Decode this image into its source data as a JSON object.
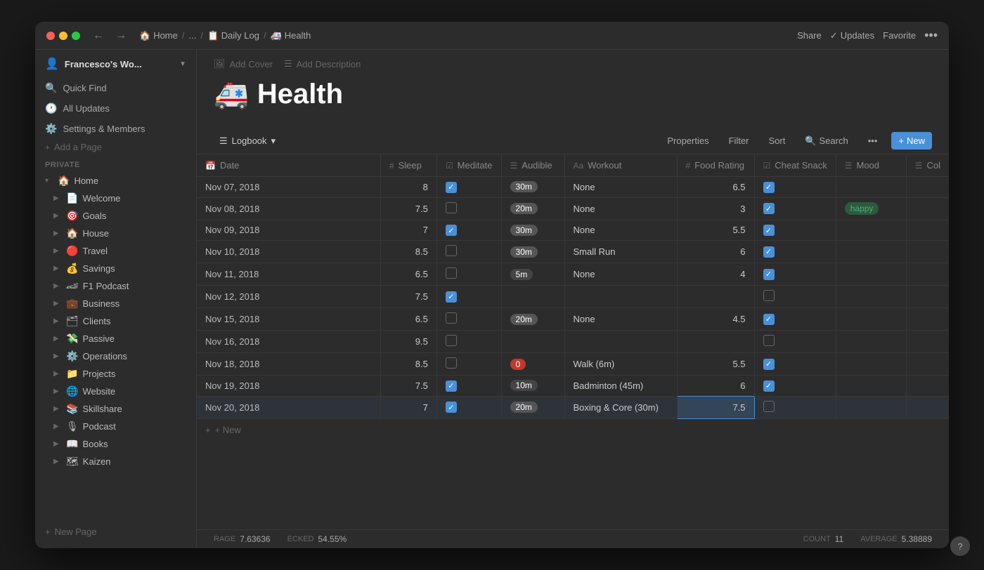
{
  "window": {
    "title": "Francesco's Wo..."
  },
  "titlebar": {
    "back_label": "←",
    "forward_label": "→",
    "breadcrumb": [
      {
        "icon": "🏠",
        "label": "Home"
      },
      {
        "sep": "/"
      },
      {
        "label": "..."
      },
      {
        "sep": "/"
      },
      {
        "icon": "📋",
        "label": "Daily Log"
      },
      {
        "sep": "/"
      },
      {
        "icon": "🚑",
        "label": "Health"
      }
    ],
    "share_label": "Share",
    "updates_label": "Updates",
    "favorite_label": "Favorite",
    "more_label": "•••"
  },
  "sidebar": {
    "workspace_name": "Francesco's Wo...",
    "search_label": "Quick Find",
    "updates_label": "All Updates",
    "settings_label": "Settings & Members",
    "add_page_label": "Add a Page",
    "section_label": "PRIVATE",
    "items": [
      {
        "icon": "🏠",
        "label": "Home",
        "expanded": true,
        "indent": 0
      },
      {
        "icon": "📄",
        "label": "Welcome",
        "indent": 1
      },
      {
        "icon": "🎯",
        "label": "Goals",
        "indent": 1
      },
      {
        "icon": "🏠",
        "label": "House",
        "indent": 1
      },
      {
        "icon": "🔴",
        "label": "Travel",
        "indent": 1
      },
      {
        "icon": "💰",
        "label": "Savings",
        "indent": 1
      },
      {
        "icon": "🏎",
        "label": "F1 Podcast",
        "indent": 1
      },
      {
        "icon": "💼",
        "label": "Business",
        "indent": 1
      },
      {
        "icon": "🗂",
        "label": "Clients",
        "indent": 1
      },
      {
        "icon": "💸",
        "label": "Passive",
        "indent": 1
      },
      {
        "icon": "⚙️",
        "label": "Operations",
        "indent": 1
      },
      {
        "icon": "📁",
        "label": "Projects",
        "indent": 1
      },
      {
        "icon": "🌐",
        "label": "Website",
        "indent": 1
      },
      {
        "icon": "📚",
        "label": "Skillshare",
        "indent": 1
      },
      {
        "icon": "🎙",
        "label": "Podcast",
        "indent": 1
      },
      {
        "icon": "📖",
        "label": "Books",
        "indent": 1
      },
      {
        "icon": "🗺",
        "label": "Kaizen",
        "indent": 1
      }
    ],
    "new_page_label": "New Page"
  },
  "page": {
    "emoji": "🚑",
    "title": "Health",
    "add_cover_label": "Add Cover",
    "add_description_label": "Add Description"
  },
  "database": {
    "view_name": "Logbook",
    "view_icon": "☰",
    "properties_label": "Properties",
    "filter_label": "Filter",
    "sort_label": "Sort",
    "search_label": "Search",
    "more_label": "•••",
    "new_label": "New",
    "columns": [
      {
        "icon": "📅",
        "label": "Date"
      },
      {
        "icon": "#",
        "label": "Sleep"
      },
      {
        "icon": "☑",
        "label": "Meditate"
      },
      {
        "icon": "☰",
        "label": "Audible"
      },
      {
        "icon": "Aa",
        "label": "Workout"
      },
      {
        "icon": "#",
        "label": "Food Rating"
      },
      {
        "icon": "☑",
        "label": "Cheat Snack"
      },
      {
        "icon": "☰",
        "label": "Mood"
      },
      {
        "icon": "☰",
        "label": "Col"
      }
    ],
    "rows": [
      {
        "date": "Nov 07, 2018",
        "sleep": "8",
        "meditate": true,
        "audible": "30m",
        "audible_type": "gray",
        "workout": "None",
        "food_rating": "6.5",
        "cheat_snack": true,
        "mood": ""
      },
      {
        "date": "Nov 08, 2018",
        "sleep": "7.5",
        "meditate": false,
        "audible": "20m",
        "audible_type": "gray",
        "workout": "None",
        "food_rating": "3",
        "cheat_snack": true,
        "mood": "happy"
      },
      {
        "date": "Nov 09, 2018",
        "sleep": "7",
        "meditate": true,
        "audible": "30m",
        "audible_type": "gray",
        "workout": "None",
        "food_rating": "5.5",
        "cheat_snack": true,
        "mood": ""
      },
      {
        "date": "Nov 10, 2018",
        "sleep": "8.5",
        "meditate": false,
        "audible": "30m",
        "audible_type": "gray",
        "workout": "Small Run",
        "food_rating": "6",
        "cheat_snack": true,
        "mood": ""
      },
      {
        "date": "Nov 11, 2018",
        "sleep": "6.5",
        "meditate": false,
        "audible": "5m",
        "audible_type": "dark",
        "workout": "None",
        "food_rating": "4",
        "cheat_snack": true,
        "mood": ""
      },
      {
        "date": "Nov 12, 2018",
        "sleep": "7.5",
        "meditate": true,
        "audible": "",
        "audible_type": "",
        "workout": "",
        "food_rating": "",
        "cheat_snack": false,
        "mood": ""
      },
      {
        "date": "Nov 15, 2018",
        "sleep": "6.5",
        "meditate": false,
        "audible": "20m",
        "audible_type": "gray",
        "workout": "None",
        "food_rating": "4.5",
        "cheat_snack": true,
        "mood": ""
      },
      {
        "date": "Nov 16, 2018",
        "sleep": "9.5",
        "meditate": false,
        "audible": "",
        "audible_type": "",
        "workout": "",
        "food_rating": "",
        "cheat_snack": false,
        "mood": ""
      },
      {
        "date": "Nov 18, 2018",
        "sleep": "8.5",
        "meditate": false,
        "audible": "0",
        "audible_type": "red",
        "workout": "Walk (6m)",
        "food_rating": "5.5",
        "cheat_snack": true,
        "mood": ""
      },
      {
        "date": "Nov 19, 2018",
        "sleep": "7.5",
        "meditate": true,
        "audible": "10m",
        "audible_type": "dark",
        "workout": "Badminton (45m)",
        "food_rating": "6",
        "cheat_snack": true,
        "mood": ""
      },
      {
        "date": "Nov 20, 2018",
        "sleep": "7",
        "meditate": true,
        "audible": "20m",
        "audible_type": "gray",
        "workout": "Boxing & Core (30m)",
        "food_rating": "7.5",
        "cheat_snack": false,
        "mood": "",
        "selected": true
      }
    ],
    "new_row_label": "+ New",
    "footer": {
      "rage_label": "RAGE",
      "rage_value": "7.63636",
      "ecked_label": "ECKED",
      "ecked_value": "54.55%",
      "count_label": "COUNT",
      "count_value": "11",
      "average_label": "AVERAGE",
      "average_value": "5.38889"
    }
  }
}
